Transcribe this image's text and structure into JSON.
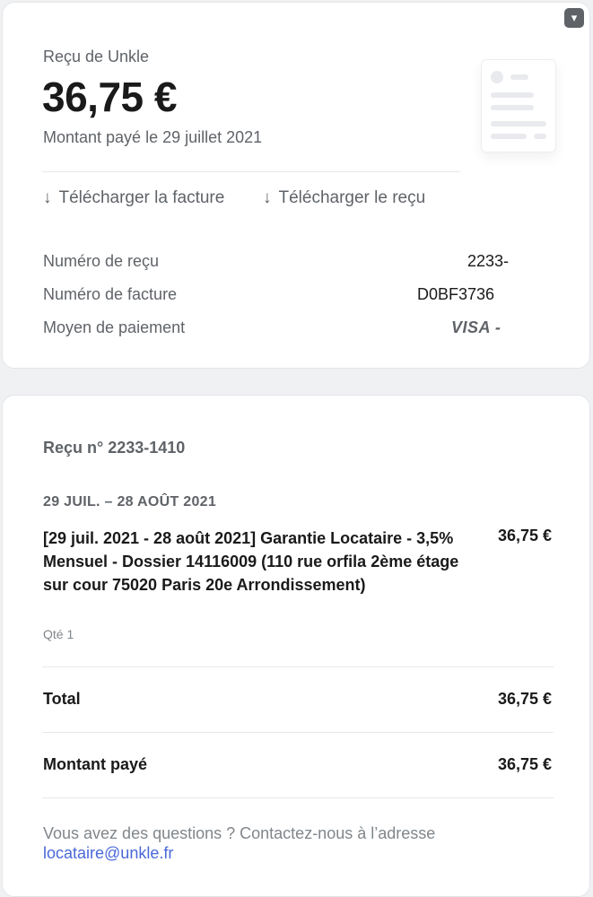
{
  "header": {
    "menu_icon": "chevron-down-icon",
    "brand_line": "Reçu de Unkle",
    "amount": "36,75 €",
    "paid_line": "Montant payé le 29 juillet 2021"
  },
  "actions": {
    "download_invoice": "Télécharger la facture",
    "download_receipt": "Télécharger le reçu",
    "download_icon": "arrow-down-icon"
  },
  "details": [
    {
      "label": "Numéro de reçu",
      "value": "2233-"
    },
    {
      "label": "Numéro de facture",
      "value": "D0BF3736"
    },
    {
      "label": "Moyen de paiement",
      "value": "VISA -"
    }
  ],
  "receipt": {
    "number_line": "Reçu n° 2233-1410",
    "period": "29 JUIL. – 28 AOÛT 2021",
    "item": {
      "description": "[29 juil. 2021 - 28 août 2021] Garantie Locataire - 3,5% Mensuel - Dossier 14116009 (110 rue orfila 2ème étage sur cour 75020 Paris 20e Arrondissement)",
      "amount": "36,75 €",
      "quantity": "Qté 1"
    },
    "total_label": "Total",
    "total_value": "36,75 €",
    "paid_label": "Montant payé",
    "paid_value": "36,75 €",
    "contact_text": "Vous avez des questions ? Contactez-nous à l’adresse",
    "contact_email": "locataire@unkle.fr"
  },
  "colors": {
    "link": "#4a68d8",
    "muted": "#5f6368",
    "text": "#1a1a1a",
    "background": "#f0f1f3"
  }
}
